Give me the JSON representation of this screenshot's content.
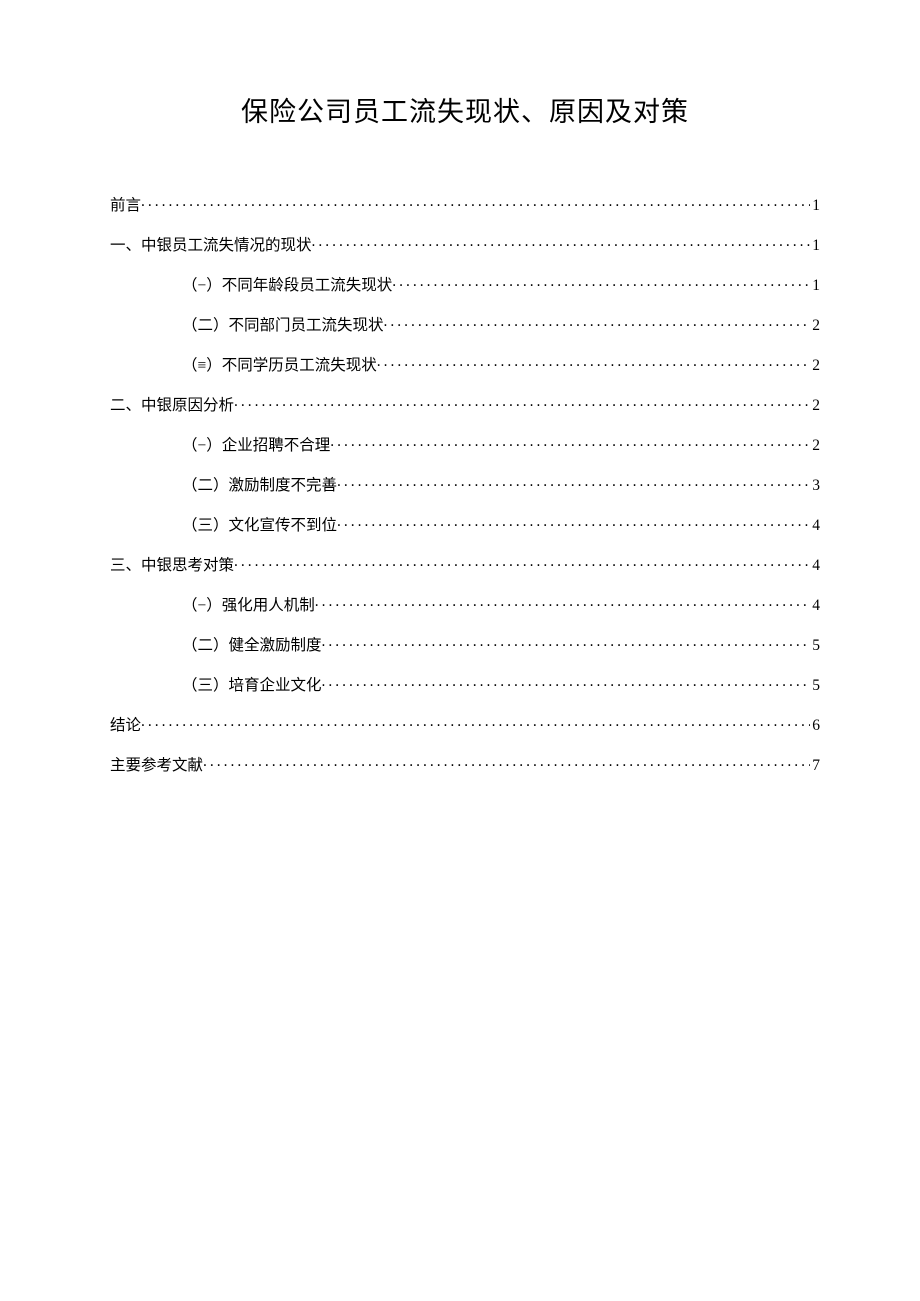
{
  "title": "保险公司员工流失现状、原因及对策",
  "toc": [
    {
      "level": 1,
      "label": "前言",
      "page": "1"
    },
    {
      "level": 1,
      "label": "一、中银员工流失情况的现状",
      "page": "1"
    },
    {
      "level": 2,
      "label": "（−）不同年龄段员工流失现状",
      "page": "1"
    },
    {
      "level": 2,
      "label": "（二）不同部门员工流失现状",
      "page": "2"
    },
    {
      "level": 2,
      "label": "（≡）不同学历员工流失现状",
      "page": "2"
    },
    {
      "level": 1,
      "label": "二、中银原因分析",
      "page": "2"
    },
    {
      "level": 2,
      "label": "（−）企业招聘不合理",
      "page": "2"
    },
    {
      "level": 2,
      "label": "（二）激励制度不完善",
      "page": "3"
    },
    {
      "level": 2,
      "label": "（三）文化宣传不到位",
      "page": "4"
    },
    {
      "level": 1,
      "label": "三、中银思考对策",
      "page": "4"
    },
    {
      "level": 2,
      "label": "（−）强化用人机制",
      "page": "4"
    },
    {
      "level": 2,
      "label": "（二）健全激励制度",
      "page": "5"
    },
    {
      "level": 2,
      "label": "（三）培育企业文化",
      "page": "5"
    },
    {
      "level": 1,
      "label": "结论",
      "page": "6"
    },
    {
      "level": 1,
      "label": "主要参考文献",
      "page": "7"
    }
  ]
}
